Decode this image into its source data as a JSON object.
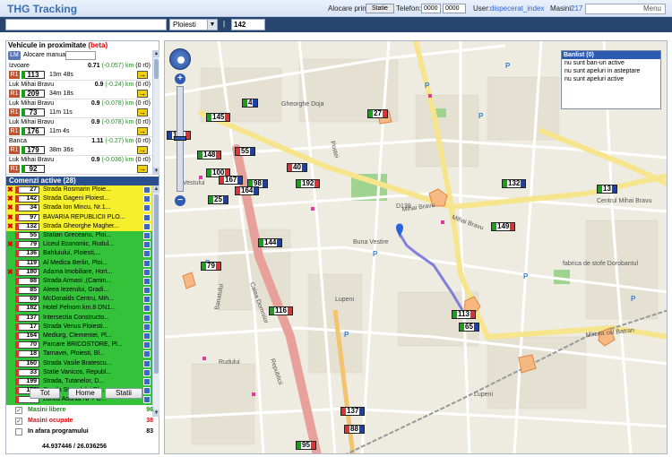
{
  "header": {
    "title": "THG Tracking",
    "alloc_label": "Alocare prin",
    "alloc_button": "Statie",
    "phone_label": "Telefon:",
    "phone_value": "0000",
    "phone_select": "0000",
    "user_label": "User:",
    "user_value": "dispecerat_index",
    "cars_label": "Masini:",
    "cars_value": "217",
    "menu_label": "Menu"
  },
  "search": {
    "query": "",
    "city": "Ploiesti",
    "separator": "|",
    "number": "142"
  },
  "nearby": {
    "title": "Vehicule in proximitate",
    "beta": "(beta)",
    "alloc_badge": "LM",
    "alloc_label": "Alocare manuala",
    "items": [
      {
        "street": "Izvoare",
        "dist": "0.71",
        "delta": "(-0.057) km",
        "rides": "(0 r0)",
        "code": "R1",
        "car": "113",
        "time": "13m 48s"
      },
      {
        "street": "Luk Mihai Bravu",
        "dist": "0.9",
        "delta": "(-0.24) km",
        "rides": "(0 r0)",
        "code": "R1",
        "car": "209",
        "time": "34m 18s"
      },
      {
        "street": "Luk Mihai Bravu",
        "dist": "0.9",
        "delta": "(-0.078) km",
        "rides": "(0 r0)",
        "code": "R1",
        "car": "73",
        "time": "11m 11s"
      },
      {
        "street": "Luk Mihai Bravu",
        "dist": "0.9",
        "delta": "(-0.078) km",
        "rides": "(0 r0)",
        "code": "R1",
        "car": "176",
        "time": "11m 4s"
      },
      {
        "street": "Banca",
        "dist": "1.11",
        "delta": "(-0.27) km",
        "rides": "(0 r0)",
        "code": "R1",
        "car": "179",
        "time": "38m 36s"
      },
      {
        "street": "Luk Mihai Bravu",
        "dist": "0.9",
        "delta": "(-0.036) km",
        "rides": "(0 r0)",
        "code": "R1",
        "car": "92",
        "time": ""
      }
    ]
  },
  "commands": {
    "title": "Comenzi active (28)",
    "rows": [
      {
        "car": "27",
        "addr": "Strada Rosmarin Ploie...",
        "color": "yellow",
        "x": true
      },
      {
        "car": "142",
        "addr": "Strada Gageni Ploiest...",
        "color": "yellow",
        "x": true
      },
      {
        "car": "34",
        "addr": "Strada Ion Mincu, Nr.1...",
        "color": "yellow",
        "x": true
      },
      {
        "car": "97",
        "addr": "BAVARIA REPUBLICII PLO...",
        "color": "yellow",
        "x": true
      },
      {
        "car": "132",
        "addr": "Strada Gheorghe Magher...",
        "color": "yellow",
        "x": true
      },
      {
        "car": "55",
        "addr": "Statian Greceanu, Ploi...",
        "color": "green",
        "x": false
      },
      {
        "car": "79",
        "addr": "Liceul Economic, Rudul...",
        "color": "green",
        "x": true
      },
      {
        "car": "136",
        "addr": "Bahluiului, Ploiesti,...",
        "color": "green",
        "x": false
      },
      {
        "car": "119",
        "addr": "Al Medica Berlin, Ploi...",
        "color": "green",
        "x": false
      },
      {
        "car": "180",
        "addr": "Adama Imobiliare, Hort...",
        "color": "green",
        "x": true
      },
      {
        "car": "88",
        "addr": "Strada Armasi ,(Camin...",
        "color": "green",
        "x": false
      },
      {
        "car": "85",
        "addr": "Aleea Iezerului, Gradi...",
        "color": "green",
        "x": false
      },
      {
        "car": "69",
        "addr": "McDonalds Centru, Mih...",
        "color": "green",
        "x": false
      },
      {
        "car": "182",
        "addr": "Hotel Pelnom km.8 DN1...",
        "color": "green",
        "x": false
      },
      {
        "car": "137",
        "addr": "Intersectia Constructo...",
        "color": "green",
        "x": false
      },
      {
        "car": "17",
        "addr": "Strada Venus Ploiesti...",
        "color": "green",
        "x": false
      },
      {
        "car": "164",
        "addr": "Mediurg, Clementei, Pl...",
        "color": "green",
        "x": false
      },
      {
        "car": "70",
        "addr": "Parcare BRICOSTORE, Pl...",
        "color": "green",
        "x": false
      },
      {
        "car": "18",
        "addr": "Tarnavei, Ploiesti, Bl...",
        "color": "green",
        "x": false
      },
      {
        "car": "160",
        "addr": "Strada Vasile Bratescu...",
        "color": "green",
        "x": false
      },
      {
        "car": "33",
        "addr": "Statie Vanicos, Republ...",
        "color": "green",
        "x": false
      },
      {
        "car": "199",
        "addr": "Strada, Tutanelor, D...",
        "color": "green",
        "x": false
      },
      {
        "car": "189",
        "addr": "Strada Strandului Plo...",
        "color": "green",
        "x": false
      },
      {
        "car": "",
        "addr": "Lunca Adunat Nr 7 D...",
        "color": "green",
        "x": false
      }
    ]
  },
  "buttons": {
    "tot": "Tot",
    "home": "Home",
    "statii": "Statii"
  },
  "stats": [
    {
      "label": "Masini libere",
      "value": "96",
      "color": "#1b8a1b",
      "checked": true
    },
    {
      "label": "Masini ocupate",
      "value": "38",
      "color": "#d01010",
      "checked": true
    },
    {
      "label": "In afara programului",
      "value": "83",
      "color": "#000000",
      "checked": false
    }
  ],
  "coords": "44.937446 / 26.036256",
  "banlist": {
    "title": "Banlist (0)",
    "lines": [
      "nu sunt ban-uri active",
      "",
      "nu sunt apeluri in asteptare",
      "",
      "nu sunt apeluri active"
    ]
  },
  "map": {
    "streets": [
      "Gheorghe Doja",
      "Mihai Bravu",
      "Postei",
      "Buna Vestire",
      "Lupeni",
      "Mihai Bravu",
      "Calea Domnilor",
      "Republicii",
      "Rudului",
      "Mircea cel Batran",
      "Banatului",
      "Vestului"
    ],
    "labels": [
      "Centrul Mihai Bravu",
      "fabrica de stofe Dorobantul",
      "Lupeni",
      "D139"
    ],
    "markers": [
      {
        "v": "4",
        "flag": "#19a019",
        "tail": "#1d3fa8"
      },
      {
        "v": "27",
        "flag": "#19a019",
        "tail": "#d33"
      },
      {
        "v": "145",
        "flag": "#19a019",
        "tail": "#d33"
      },
      {
        "v": "101",
        "flag": "#1d3fa8",
        "tail": "#d33"
      },
      {
        "v": "55",
        "flag": "#d33",
        "tail": "#1d3fa8"
      },
      {
        "v": "148",
        "flag": "#19a019",
        "tail": "#d33"
      },
      {
        "v": "40",
        "flag": "#d33",
        "tail": "#1d3fa8"
      },
      {
        "v": "100",
        "flag": "#19a019",
        "tail": "#d33"
      },
      {
        "v": "167",
        "flag": "#d33",
        "tail": "#1d3fa8"
      },
      {
        "v": "98",
        "flag": "#19a019",
        "tail": "#1d3fa8"
      },
      {
        "v": "192",
        "flag": "#19a019",
        "tail": "#d33"
      },
      {
        "v": "164",
        "flag": "#d33",
        "tail": "#1d3fa8"
      },
      {
        "v": "132",
        "flag": "#19a019",
        "tail": "#1d3fa8"
      },
      {
        "v": "25",
        "flag": "#19a019",
        "tail": "#1d3fa8"
      },
      {
        "v": "13",
        "flag": "#19a019",
        "tail": "#1d3fa8"
      },
      {
        "v": "149",
        "flag": "#19a019",
        "tail": "#d33"
      },
      {
        "v": "144",
        "flag": "#19a019",
        "tail": "#1d3fa8"
      },
      {
        "v": "79",
        "flag": "#19a019",
        "tail": "#d33"
      },
      {
        "v": "116",
        "flag": "#19a019",
        "tail": "#d33"
      },
      {
        "v": "113",
        "flag": "#19a019",
        "tail": "#d33"
      },
      {
        "v": "65",
        "flag": "#19a019",
        "tail": "#1d3fa8"
      },
      {
        "v": "137",
        "flag": "#d33",
        "tail": "#1d3fa8"
      },
      {
        "v": "88",
        "flag": "#d33",
        "tail": "#1d3fa8"
      },
      {
        "v": "95",
        "flag": "#19a019",
        "tail": "#d33"
      }
    ]
  },
  "colors": {
    "header_bar": "#27456f",
    "title_blue": "#3a6fb3",
    "green_row": "#34c23a",
    "yellow_row": "#f5ee2a",
    "route": "#6e6cdc"
  }
}
